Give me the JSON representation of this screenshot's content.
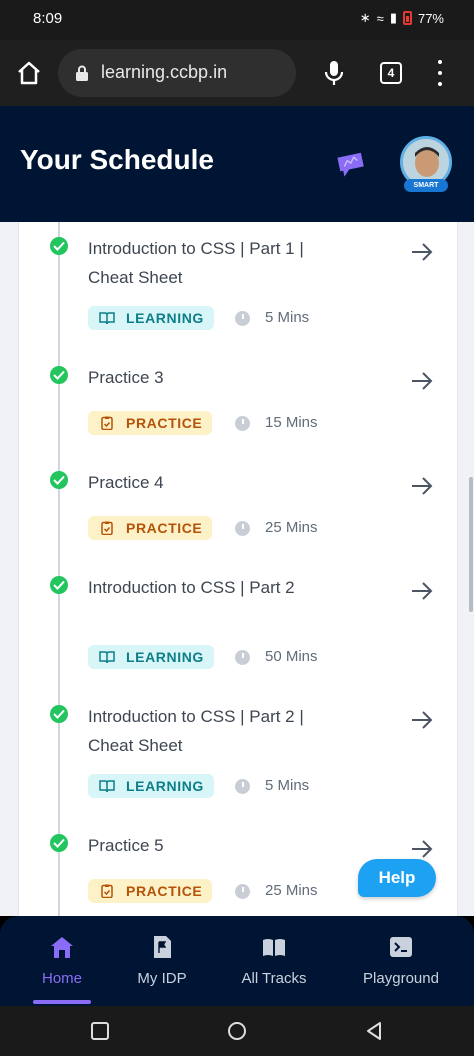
{
  "status_bar": {
    "time": "8:09",
    "battery": "77%"
  },
  "browser": {
    "url": "learning.ccbp.in",
    "tab_count": "4"
  },
  "header": {
    "title": "Your Schedule",
    "avatar_badge": "SMART"
  },
  "items": [
    {
      "title": "Introduction to CSS | Part 1 | Cheat Sheet",
      "tag": "LEARNING",
      "duration": "5 Mins"
    },
    {
      "title": "Practice 3",
      "tag": "PRACTICE",
      "duration": "15 Mins"
    },
    {
      "title": "Practice 4",
      "tag": "PRACTICE",
      "duration": "25 Mins"
    },
    {
      "title": "Introduction to CSS | Part 2",
      "tag": "LEARNING",
      "duration": "50 Mins"
    },
    {
      "title": "Introduction to CSS | Part 2 | Cheat Sheet",
      "tag": "LEARNING",
      "duration": "5 Mins"
    },
    {
      "title": "Practice 5",
      "tag": "PRACTICE",
      "duration": "25 Mins"
    }
  ],
  "help": {
    "label": "Help"
  },
  "bottom_nav": [
    {
      "label": "Home",
      "icon": "home-icon",
      "active": true
    },
    {
      "label": "My IDP",
      "icon": "flag-document-icon",
      "active": false
    },
    {
      "label": "All Tracks",
      "icon": "book-open-icon",
      "active": false
    },
    {
      "label": "Playground",
      "icon": "terminal-icon",
      "active": false
    }
  ],
  "colors": {
    "header_bg": "#001533",
    "accent": "#8b6cf6",
    "success": "#22c55e",
    "learning_bg": "#d8f5f7",
    "learning_text": "#0d7f89",
    "practice_bg": "#fdf1c8",
    "practice_text": "#b45309",
    "help_bg": "#1da1f2"
  }
}
